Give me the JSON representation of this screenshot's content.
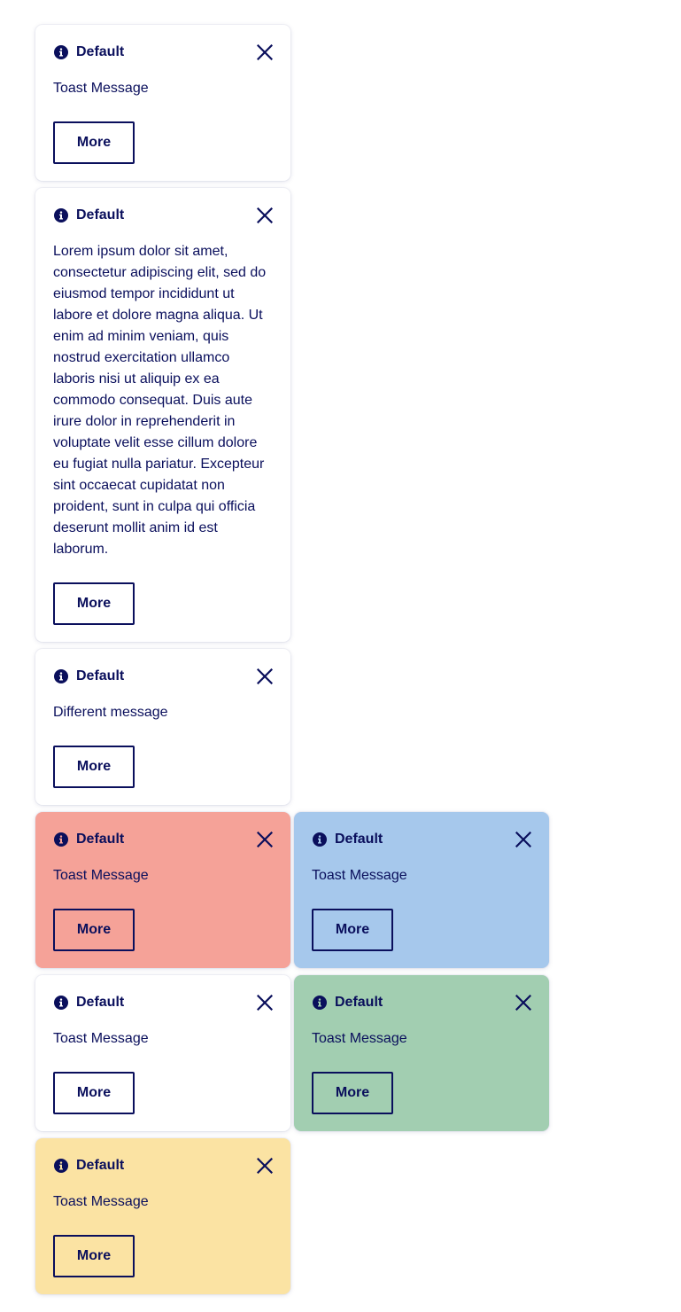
{
  "colors": {
    "text": "#0a0f5c",
    "default_bg": "#ffffff",
    "error_bg": "#f5a298",
    "info_bg": "#a6c8ec",
    "success_bg": "#a2ceb1",
    "warning_bg": "#fbe3a3"
  },
  "icons": {
    "leading": "info-icon",
    "dismiss": "close-icon"
  },
  "toasts": [
    {
      "variant": "default",
      "title": "Default",
      "message": "Toast Message",
      "action_label": "More"
    },
    {
      "variant": "default",
      "title": "Default",
      "message": "Lorem ipsum dolor sit amet, consectetur adipiscing elit, sed do eiusmod tempor incididunt ut labore et dolore magna aliqua. Ut enim ad minim veniam, quis nostrud exercitation ullamco laboris nisi ut aliquip ex ea commodo consequat. Duis aute irure dolor in reprehenderit in voluptate velit esse cillum dolore eu fugiat nulla pariatur. Excepteur sint occaecat cupidatat non proident, sunt in culpa qui officia deserunt mollit anim id est laborum.",
      "action_label": "More"
    },
    {
      "variant": "default",
      "title": "Default",
      "message": "Different message",
      "action_label": "More"
    },
    {
      "variant": "error",
      "title": "Default",
      "message": "Toast Message",
      "action_label": "More"
    },
    {
      "variant": "info",
      "title": "Default",
      "message": "Toast Message",
      "action_label": "More"
    },
    {
      "variant": "default",
      "title": "Default",
      "message": "Toast Message",
      "action_label": "More"
    },
    {
      "variant": "success",
      "title": "Default",
      "message": "Toast Message",
      "action_label": "More"
    },
    {
      "variant": "warning",
      "title": "Default",
      "message": "Toast Message",
      "action_label": "More"
    }
  ]
}
